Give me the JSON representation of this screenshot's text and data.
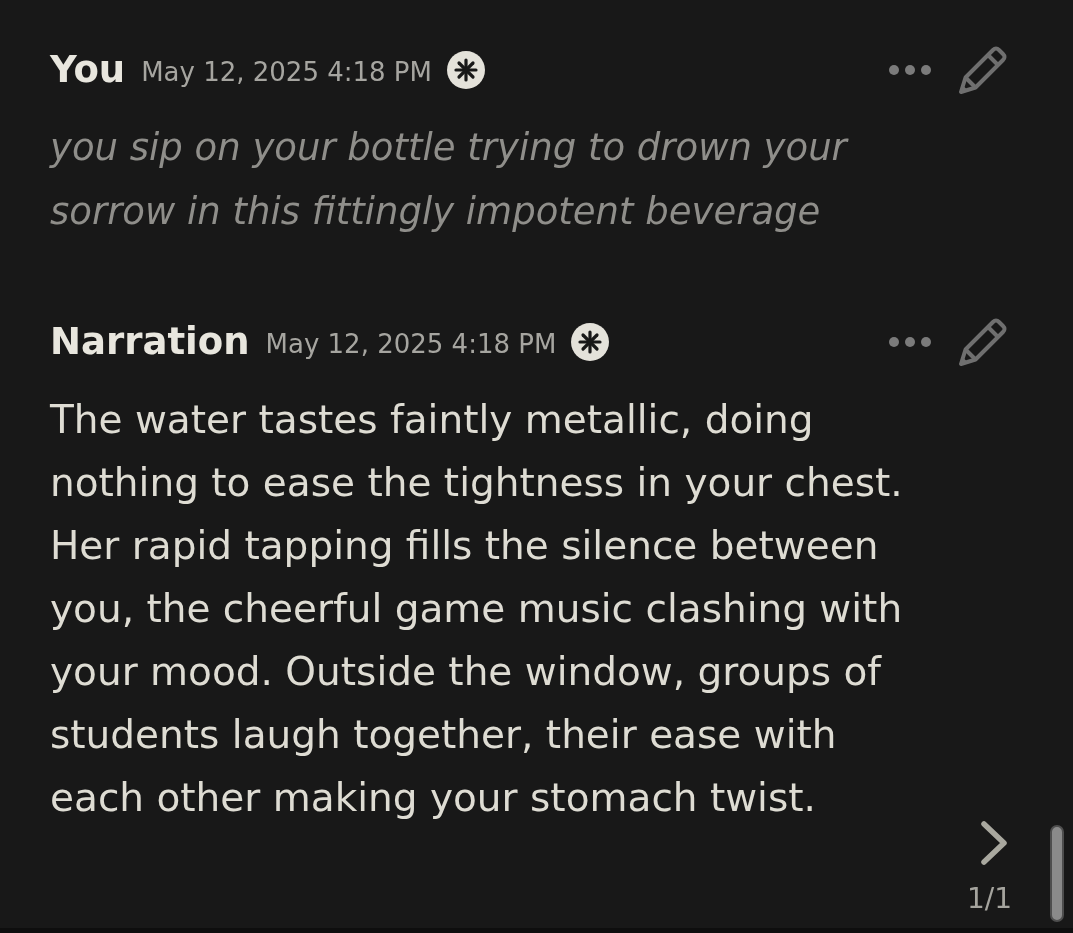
{
  "messages": [
    {
      "kind": "user",
      "author": "You",
      "timestamp": "May 12, 2025 4:18 PM",
      "text": "you sip on your bottle trying to drown your sorrow in this fittingly impotent beverage"
    },
    {
      "kind": "narration",
      "author": "Narration",
      "timestamp": "May 12, 2025 4:18 PM",
      "text": "The water tastes faintly metallic, doing nothing to ease the tightness in your chest. Her rapid tapping fills the silence between you, the cheerful game music clashing with your mood. Outside the window, groups of students laugh together, their ease with each other making your stomach twist.",
      "swipe_counter": "1/1"
    }
  ]
}
